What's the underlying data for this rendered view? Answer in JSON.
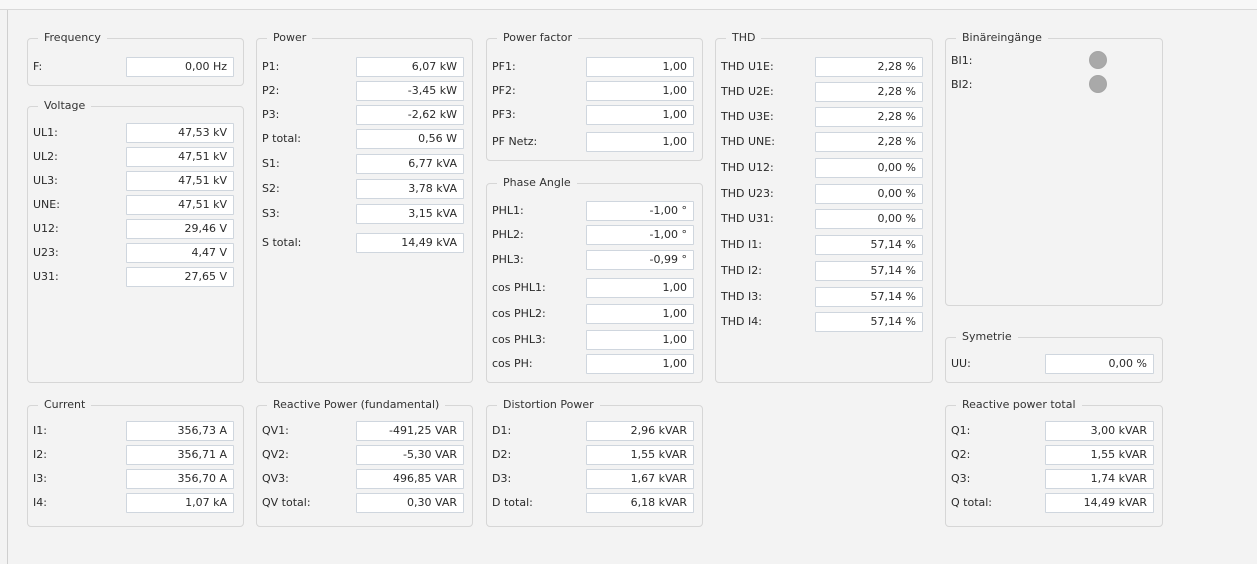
{
  "frequency": {
    "title": "Frequency",
    "rows": [
      {
        "label": "F:",
        "value": "0,00 Hz"
      }
    ]
  },
  "voltage": {
    "title": "Voltage",
    "rows": [
      {
        "label": "UL1:",
        "value": "47,53 kV"
      },
      {
        "label": "UL2:",
        "value": "47,51 kV"
      },
      {
        "label": "UL3:",
        "value": "47,51 kV"
      },
      {
        "label": "UNE:",
        "value": "47,51 kV"
      },
      {
        "label": "U12:",
        "value": "29,46 V"
      },
      {
        "label": "U23:",
        "value": "4,47 V"
      },
      {
        "label": "U31:",
        "value": "27,65 V"
      }
    ]
  },
  "current": {
    "title": "Current",
    "rows": [
      {
        "label": "I1:",
        "value": "356,73 A"
      },
      {
        "label": "I2:",
        "value": "356,71 A"
      },
      {
        "label": "I3:",
        "value": "356,70 A"
      },
      {
        "label": "I4:",
        "value": "1,07 kA"
      }
    ]
  },
  "power": {
    "title": "Power",
    "rows": [
      {
        "label": "P1:",
        "value": "6,07 kW"
      },
      {
        "label": "P2:",
        "value": "-3,45 kW"
      },
      {
        "label": "P3:",
        "value": "-2,62 kW"
      },
      {
        "label": "P total:",
        "value": "0,56 W"
      },
      {
        "label": "S1:",
        "value": "6,77 kVA"
      },
      {
        "label": "S2:",
        "value": "3,78 kVA"
      },
      {
        "label": "S3:",
        "value": "3,15 kVA"
      },
      {
        "label": "S total:",
        "value": "14,49 kVA"
      }
    ]
  },
  "reactive_fundamental": {
    "title": "Reactive Power (fundamental)",
    "rows": [
      {
        "label": "QV1:",
        "value": "-491,25 VAR"
      },
      {
        "label": "QV2:",
        "value": "-5,30 VAR"
      },
      {
        "label": "QV3:",
        "value": "496,85 VAR"
      },
      {
        "label": "QV total:",
        "value": "0,30 VAR"
      }
    ]
  },
  "power_factor": {
    "title": "Power factor",
    "rows": [
      {
        "label": "PF1:",
        "value": "1,00"
      },
      {
        "label": "PF2:",
        "value": "1,00"
      },
      {
        "label": "PF3:",
        "value": "1,00"
      },
      {
        "label": "PF Netz:",
        "value": "1,00"
      }
    ]
  },
  "phase_angle": {
    "title": "Phase Angle",
    "rows": [
      {
        "label": "PHL1:",
        "value": "-1,00 °"
      },
      {
        "label": "PHL2:",
        "value": "-1,00 °"
      },
      {
        "label": "PHL3:",
        "value": "-0,99 °"
      },
      {
        "label": "cos PHL1:",
        "value": "1,00"
      },
      {
        "label": "cos PHL2:",
        "value": "1,00"
      },
      {
        "label": "cos PHL3:",
        "value": "1,00"
      },
      {
        "label": "cos PH:",
        "value": "1,00"
      }
    ]
  },
  "distortion": {
    "title": "Distortion Power",
    "rows": [
      {
        "label": "D1:",
        "value": "2,96 kVAR"
      },
      {
        "label": "D2:",
        "value": "1,55 kVAR"
      },
      {
        "label": "D3:",
        "value": "1,67 kVAR"
      },
      {
        "label": "D total:",
        "value": "6,18 kVAR"
      }
    ]
  },
  "thd": {
    "title": "THD",
    "rows": [
      {
        "label": "THD U1E:",
        "value": "2,28 %"
      },
      {
        "label": "THD U2E:",
        "value": "2,28 %"
      },
      {
        "label": "THD U3E:",
        "value": "2,28 %"
      },
      {
        "label": "THD UNE:",
        "value": "2,28 %"
      },
      {
        "label": "THD U12:",
        "value": "0,00 %"
      },
      {
        "label": "THD U23:",
        "value": "0,00 %"
      },
      {
        "label": "THD U31:",
        "value": "0,00 %"
      },
      {
        "label": "THD I1:",
        "value": "57,14 %"
      },
      {
        "label": "THD I2:",
        "value": "57,14 %"
      },
      {
        "label": "THD I3:",
        "value": "57,14 %"
      },
      {
        "label": "THD I4:",
        "value": "57,14 %"
      }
    ]
  },
  "binary": {
    "title": "Binäreingänge",
    "rows": [
      {
        "label": "BI1:",
        "state_color": "#a9a9a9"
      },
      {
        "label": "BI2:",
        "state_color": "#a9a9a9"
      }
    ]
  },
  "symmetry": {
    "title": "Symetrie",
    "rows": [
      {
        "label": "UU:",
        "value": "0,00 %"
      }
    ]
  },
  "reactive_total": {
    "title": "Reactive power total",
    "rows": [
      {
        "label": "Q1:",
        "value": "3,00 kVAR"
      },
      {
        "label": "Q2:",
        "value": "1,55 kVAR"
      },
      {
        "label": "Q3:",
        "value": "1,74 kVAR"
      },
      {
        "label": "Q total:",
        "value": "14,49 kVAR"
      }
    ]
  }
}
